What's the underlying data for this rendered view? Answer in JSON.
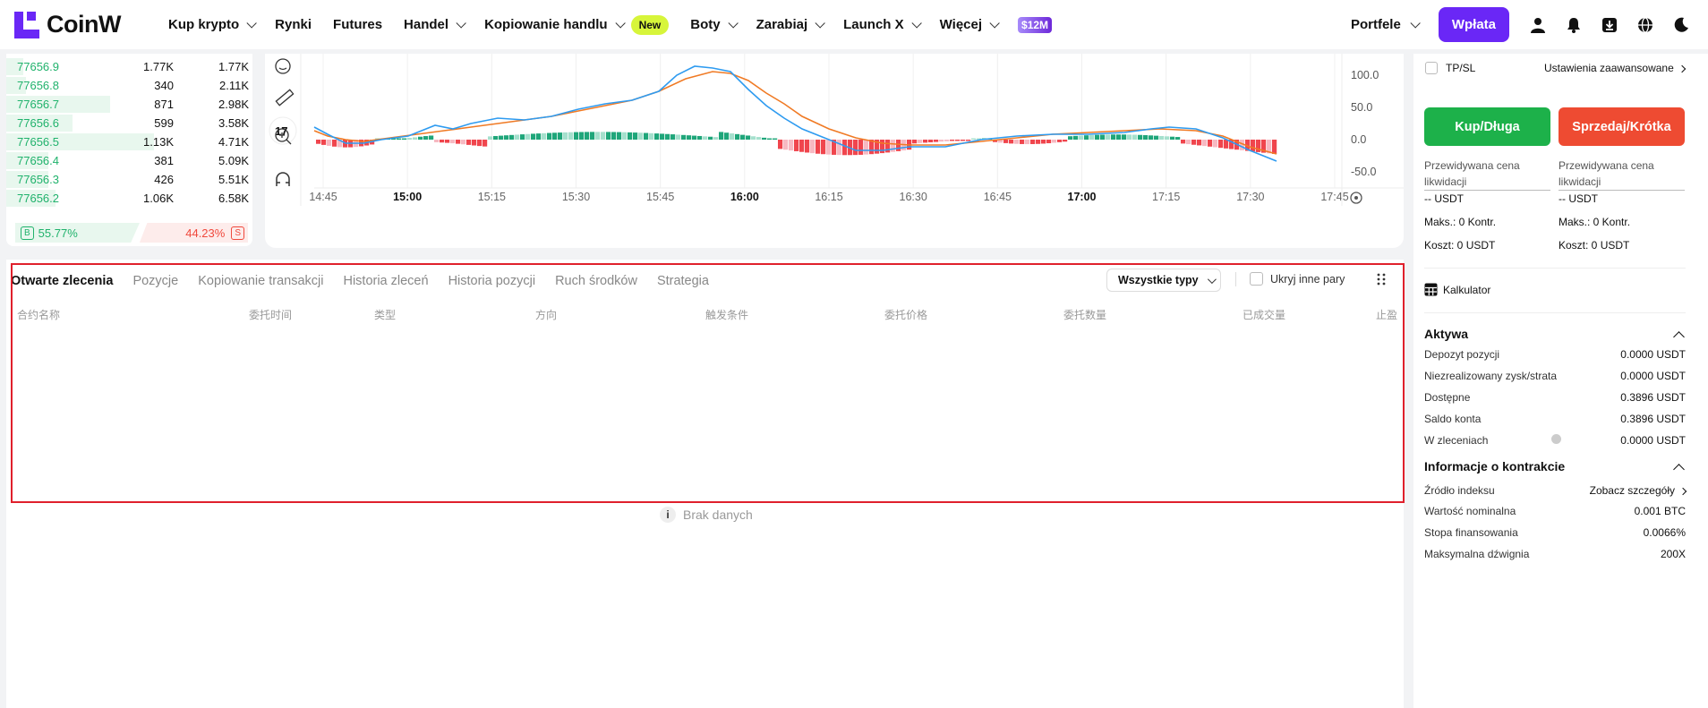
{
  "header": {
    "logo_text": "CoinW",
    "nav": [
      {
        "label": "Kup krypto",
        "dropdown": true
      },
      {
        "label": "Rynki",
        "dropdown": false
      },
      {
        "label": "Futures",
        "dropdown": false
      },
      {
        "label": "Handel",
        "dropdown": true
      },
      {
        "label": "Kopiowanie handlu",
        "dropdown": true,
        "badge": "New"
      },
      {
        "label": "Boty",
        "dropdown": true
      },
      {
        "label": "Zarabiaj",
        "dropdown": true
      },
      {
        "label": "Launch X",
        "dropdown": true
      },
      {
        "label": "Więcej",
        "dropdown": true
      }
    ],
    "promo": "$12M",
    "wallets_label": "Portfele",
    "deposit_label": "Wpłata",
    "icons": [
      "user-icon",
      "bell-icon",
      "download-icon",
      "globe-icon",
      "moon-icon"
    ]
  },
  "orderbook": {
    "rows": [
      {
        "price": "77656.9",
        "qty": "1.77K",
        "total": "1.77K",
        "depth": 0.07
      },
      {
        "price": "77656.8",
        "qty": "340",
        "total": "2.11K",
        "depth": 0.08
      },
      {
        "price": "77656.7",
        "qty": "871",
        "total": "2.98K",
        "depth": 0.42
      },
      {
        "price": "77656.6",
        "qty": "599",
        "total": "3.58K",
        "depth": 0.27
      },
      {
        "price": "77656.5",
        "qty": "1.13K",
        "total": "4.71K",
        "depth": 0.6
      },
      {
        "price": "77656.4",
        "qty": "381",
        "total": "5.09K",
        "depth": 0.17
      },
      {
        "price": "77656.3",
        "qty": "426",
        "total": "5.51K",
        "depth": 0.17
      },
      {
        "price": "77656.2",
        "qty": "1.06K",
        "total": "6.58K",
        "depth": 0.2
      }
    ],
    "buy_tag": "B",
    "buy_ratio": "55.77%",
    "sell_ratio": "44.23%",
    "sell_tag": "S"
  },
  "chart": {
    "y_ticks": [
      "100.0",
      "50.0",
      "0.0",
      "-50.0"
    ],
    "x_ticks": [
      {
        "label": "14:45",
        "bold": false
      },
      {
        "label": "15:00",
        "bold": true
      },
      {
        "label": "15:15",
        "bold": false
      },
      {
        "label": "15:30",
        "bold": false
      },
      {
        "label": "15:45",
        "bold": false
      },
      {
        "label": "16:00",
        "bold": true
      },
      {
        "label": "16:15",
        "bold": false
      },
      {
        "label": "16:30",
        "bold": false
      },
      {
        "label": "16:45",
        "bold": false
      },
      {
        "label": "17:00",
        "bold": true
      },
      {
        "label": "17:15",
        "bold": false
      },
      {
        "label": "17:30",
        "bold": false
      },
      {
        "label": "17:45",
        "bold": false
      }
    ],
    "tools": [
      "emoji-icon",
      "ruler-icon",
      "zoom-in-icon",
      "magnet-icon"
    ],
    "colors": {
      "macd": "#2e9bf0",
      "signal": "#f07a24",
      "hist_up": "#1fa67a",
      "hist_up_light": "#a5e0cd",
      "hist_down": "#f0454d",
      "hist_down_light": "#f7b9c2"
    }
  },
  "orders": {
    "tabs": [
      "Otwarte zlecenia",
      "Pozycje",
      "Kopiowanie transakcji",
      "Historia zleceń",
      "Historia pozycji",
      "Ruch środków",
      "Strategia"
    ],
    "type_select": "Wszystkie typy",
    "hide_pairs_label": "Ukryj inne pary",
    "columns": [
      "合约名称",
      "委托时间",
      "类型",
      "方向",
      "触发条件",
      "委托价格",
      "委托数量",
      "已成交量",
      "止盈"
    ],
    "empty_text": "Brak danych"
  },
  "trade_panel": {
    "tpsl_label": "TP/SL",
    "advanced_label": "Ustawienia zaawansowane",
    "buy_label": "Kup/Długa",
    "sell_label": "Sprzedaj/Krótka",
    "liq_label_1": "Przewidywana cena",
    "liq_label_2": "likwidacji",
    "liq_value": "-- USDT",
    "max_label": "Maks.: 0 Kontr.",
    "cost_label": "Koszt: 0 USDT",
    "calculator_label": "Kalkulator"
  },
  "assets": {
    "title": "Aktywa",
    "rows": [
      {
        "k": "Depozyt pozycji",
        "v": "0.0000 USDT"
      },
      {
        "k": "Niezrealizowany zysk/strata",
        "v": "0.0000 USDT"
      },
      {
        "k": "Dostępne",
        "v": "0.3896 USDT"
      },
      {
        "k": "Saldo konta",
        "v": "0.3896 USDT"
      },
      {
        "k": "W zleceniach",
        "v": "0.0000 USDT"
      }
    ]
  },
  "contract": {
    "title": "Informacje o kontrakcie",
    "index_label": "Źródło indeksu",
    "index_link": "Zobacz szczegóły",
    "rows": [
      {
        "k": "Wartość nominalna",
        "v": "0.001 BTC"
      },
      {
        "k": "Stopa finansowania",
        "v": "0.0066%"
      },
      {
        "k": "Maksymalna dźwignia",
        "v": "200X"
      }
    ]
  }
}
